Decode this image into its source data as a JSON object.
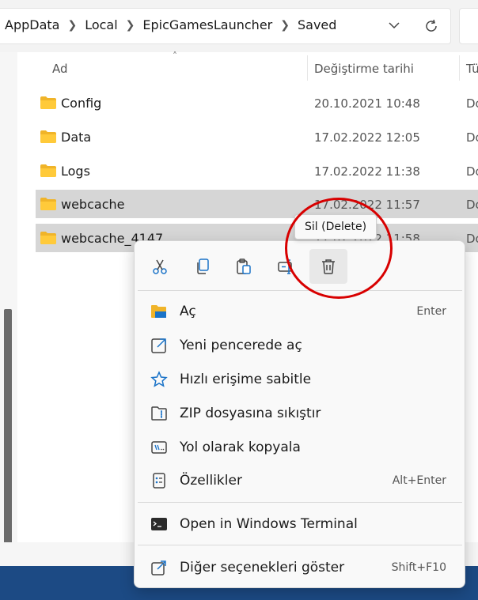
{
  "breadcrumb": [
    "AppData",
    "Local",
    "EpicGamesLauncher",
    "Saved"
  ],
  "columns": {
    "name": "Ad",
    "date": "Değiştirme tarihi",
    "type": "Tü"
  },
  "files": [
    {
      "name": "Config",
      "date": "20.10.2021 10:48",
      "type": "Do",
      "selected": false
    },
    {
      "name": "Data",
      "date": "17.02.2022 12:05",
      "type": "Do",
      "selected": false
    },
    {
      "name": "Logs",
      "date": "17.02.2022 11:38",
      "type": "Do",
      "selected": false
    },
    {
      "name": "webcache",
      "date": "17.02.2022 11:57",
      "type": "Do",
      "selected": true
    },
    {
      "name": "webcache_4147",
      "date": "17.02.2022 11:58",
      "type": "Do",
      "selected": true
    }
  ],
  "tooltip": {
    "text": "Sil (Delete)"
  },
  "quick_actions": [
    "cut-icon",
    "copy-icon",
    "paste-icon",
    "rename-icon",
    "delete-icon"
  ],
  "menu": {
    "items": [
      {
        "label": "Aç",
        "shortcut": "Enter",
        "icon": "folder-open-icon"
      },
      {
        "label": "Yeni pencerede aç",
        "shortcut": "",
        "icon": "new-window-icon"
      },
      {
        "label": "Hızlı erişime sabitle",
        "shortcut": "",
        "icon": "star-icon"
      },
      {
        "label": "ZIP dosyasına sıkıştır",
        "shortcut": "",
        "icon": "zip-icon"
      },
      {
        "label": "Yol olarak kopyala",
        "shortcut": "",
        "icon": "copy-path-icon"
      },
      {
        "label": "Özellikler",
        "shortcut": "Alt+Enter",
        "icon": "properties-icon"
      }
    ],
    "terminal": {
      "label": "Open in Windows Terminal",
      "icon": "terminal-icon"
    },
    "more": {
      "label": "Diğer seçenekleri göster",
      "shortcut": "Shift+F10",
      "icon": "more-options-icon"
    }
  },
  "colors": {
    "accent": "#1a73c8",
    "selection": "#d6d6d6",
    "annotation": "#d80000",
    "taskbar": "#1c4a84"
  }
}
